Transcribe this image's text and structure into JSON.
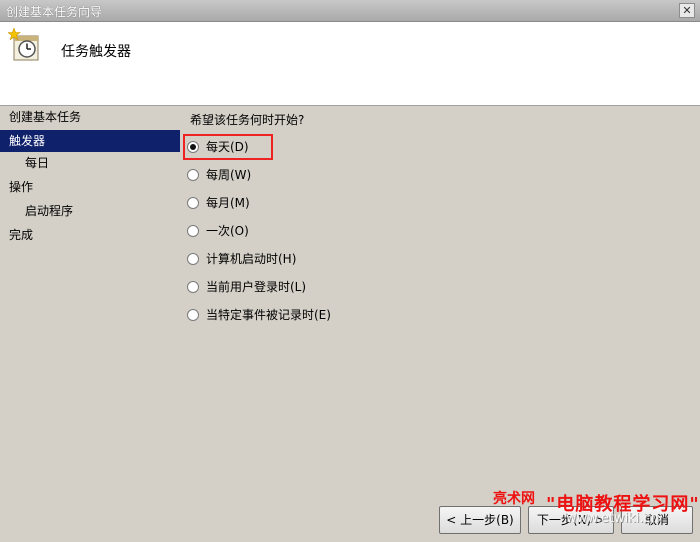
{
  "window": {
    "title": "创建基本任务向导",
    "close_glyph": "✕"
  },
  "header": {
    "title": "任务触发器",
    "icon": "task-clock-icon"
  },
  "sidebar": {
    "items": [
      {
        "label": "创建基本任务",
        "indent": false,
        "active": false
      },
      {
        "label": "触发器",
        "indent": false,
        "active": true
      },
      {
        "label": "每日",
        "indent": true,
        "active": false
      },
      {
        "label": "操作",
        "indent": false,
        "active": false
      },
      {
        "label": "启动程序",
        "indent": true,
        "active": false
      },
      {
        "label": "完成",
        "indent": false,
        "active": false
      }
    ]
  },
  "main": {
    "question": "希望该任务何时开始?",
    "options": [
      {
        "label": "每天(D)",
        "checked": true
      },
      {
        "label": "每周(W)",
        "checked": false
      },
      {
        "label": "每月(M)",
        "checked": false
      },
      {
        "label": "一次(O)",
        "checked": false
      },
      {
        "label": "计算机启动时(H)",
        "checked": false
      },
      {
        "label": "当前用户登录时(L)",
        "checked": false
      },
      {
        "label": "当特定事件被记录时(E)",
        "checked": false
      }
    ]
  },
  "buttons": {
    "back": "< 上一步(B)",
    "next": "下一步(N) >",
    "cancel": "取消"
  },
  "watermark": {
    "site": "亮术网",
    "brand": "\"电脑教程学习网\"",
    "url": "www.etwiki.cn"
  }
}
